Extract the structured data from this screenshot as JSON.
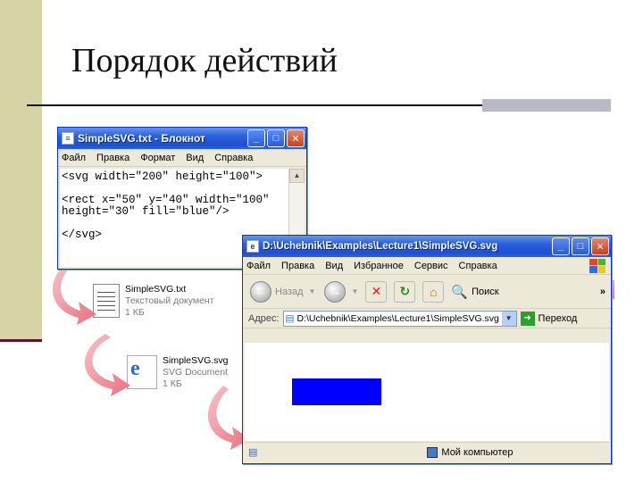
{
  "slide": {
    "title": "Порядок действий"
  },
  "notepad": {
    "title": "SimpleSVG.txt - Блокнот",
    "menu": [
      "Файл",
      "Правка",
      "Формат",
      "Вид",
      "Справка"
    ],
    "content": "<svg width=\"200\" height=\"100\">\n\n<rect x=\"50\" y=\"40\" width=\"100\"\nheight=\"30\" fill=\"blue\"/>\n\n</svg>"
  },
  "files": [
    {
      "name": "SimpleSVG.txt",
      "type": "Текстовый документ",
      "size": "1 КБ",
      "icon": "text-document-icon"
    },
    {
      "name": "SimpleSVG.svg",
      "type": "SVG Document",
      "size": "1 КБ",
      "icon": "ie-document-icon"
    }
  ],
  "browser": {
    "title": "D:\\Uchebnik\\Examples\\Lecture1\\SimpleSVG.svg",
    "menu": [
      "Файл",
      "Правка",
      "Вид",
      "Избранное",
      "Сервис",
      "Справка"
    ],
    "toolbar": {
      "back": "Назад",
      "search": "Поиск",
      "more": "»"
    },
    "address_label": "Адрес:",
    "address_value": "D:\\Uchebnik\\Examples\\Lecture1\\SimpleSVG.svg",
    "go_label": "Переход",
    "status": "Мой компьютер",
    "rect_fill": "#0000ff"
  },
  "colors": {
    "accent_band": "#d6d3a5",
    "xp_title": "#2b5fdb",
    "arrow": "#f0a0a8"
  }
}
